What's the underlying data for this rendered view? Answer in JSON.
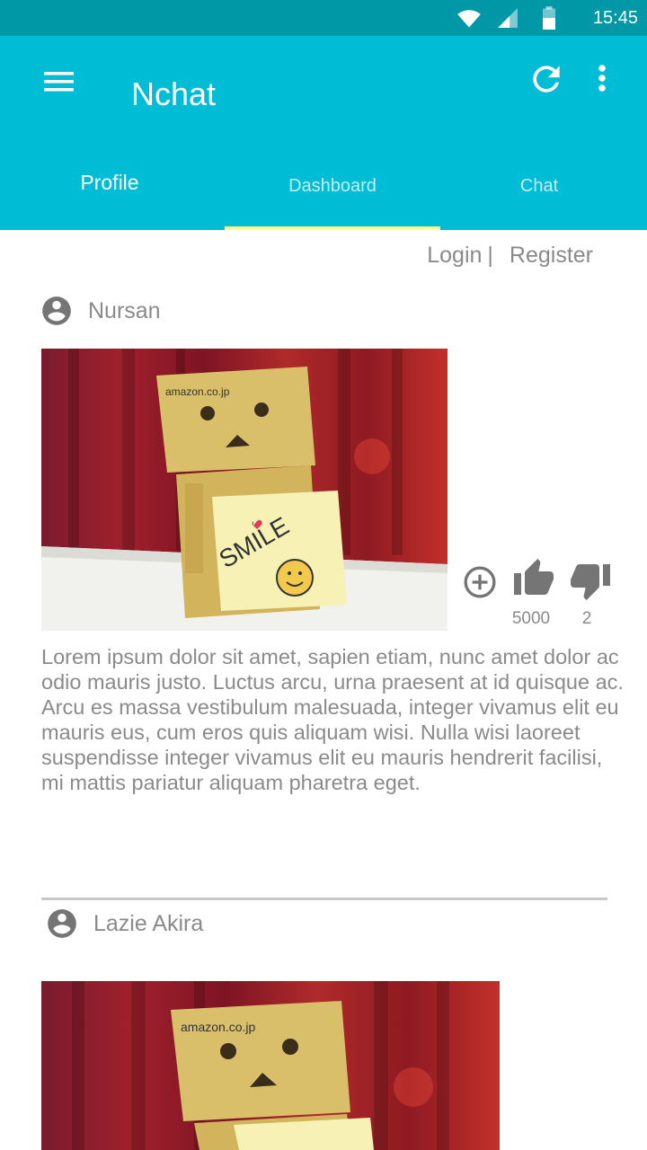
{
  "status_bar": {
    "time": "15:45",
    "icons": [
      "wifi-icon",
      "signal-icon",
      "battery-icon"
    ]
  },
  "app_bar": {
    "title": "Nchat",
    "menu_icon": "hamburger-menu-icon",
    "refresh_icon": "refresh-icon",
    "more_icon": "more-vertical-icon"
  },
  "tabs": [
    {
      "label": "Profile"
    },
    {
      "label": "Dashboard",
      "selected": true
    },
    {
      "label": "Chat"
    }
  ],
  "auth": {
    "login": "Login",
    "separator": "|",
    "register": "Register"
  },
  "posts": [
    {
      "author": "Nursan",
      "image": "danbo cardboard robot holding smile note",
      "image_box_text": "amazon.co.jp",
      "image_note_text": "SMILE",
      "likes": "5000",
      "dislikes": "2",
      "body": "Lorem ipsum dolor sit amet, sapien etiam, nunc amet dolor ac odio mauris justo. Luctus arcu, urna praesent at id quisque ac. Arcu es massa vestibulum malesuada, integer vivamus elit eu mauris eus, cum eros quis aliquam wisi. Nulla wisi laoreet suspendisse integer vivamus elit eu mauris hendrerit facilisi, mi mattis pariatur aliquam pharetra eget."
    },
    {
      "author": "Lazie Akira",
      "image": "danbo cardboard robot holding smile note",
      "image_box_text": "amazon.co.jp"
    }
  ],
  "colors": {
    "status_bar": "#0097a7",
    "app_bar": "#00bcd4",
    "tab_indicator": "#ffff8d",
    "secondary_text": "#8a8a8a",
    "icon": "#757575"
  }
}
